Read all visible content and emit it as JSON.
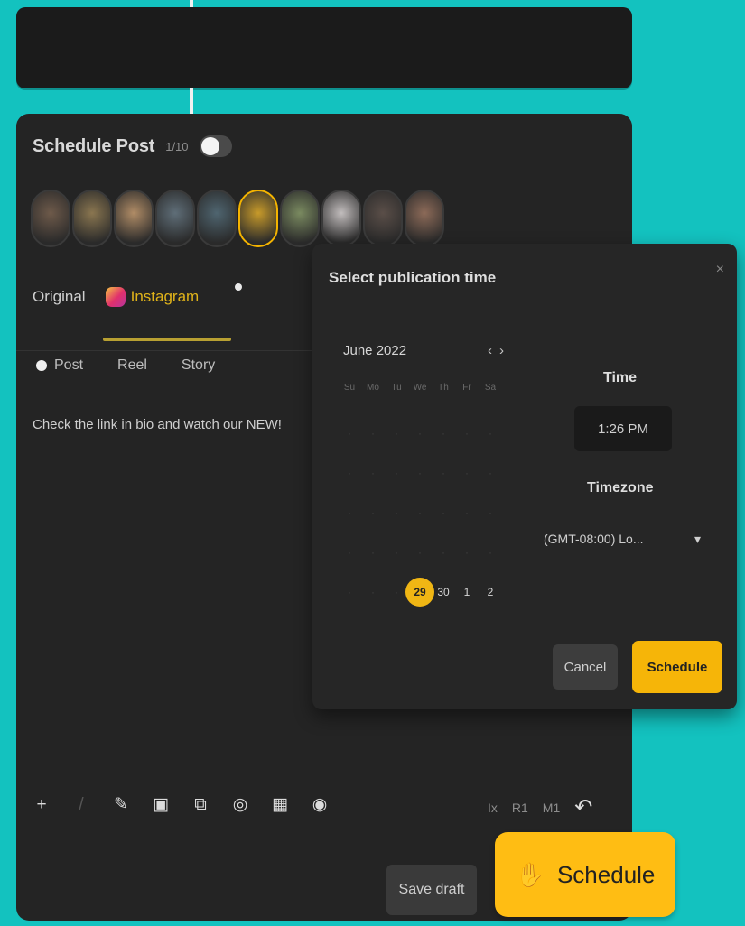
{
  "colors": {
    "page_bg": "#13c2bf",
    "panel_bg": "#242424",
    "accent": "#f6b508",
    "instagram_text": "#e0b31a"
  },
  "header": {
    "title": "Schedule Post",
    "count": "1/10",
    "toggle_on": true
  },
  "avatars": {
    "count": 10,
    "selected_index": 5,
    "colors": [
      "#6e5a4a",
      "#8a7650",
      "#b08c66",
      "#5f6e78",
      "#4f6570",
      "#c79a2a",
      "#7a8a60",
      "#c2bdbd",
      "#5a4e48",
      "#8c6a58"
    ]
  },
  "platform_tabs": {
    "original": "Original",
    "instagram": "Instagram"
  },
  "content_tabs": {
    "post": "Post",
    "reel": "Reel",
    "story": "Story"
  },
  "caption": "Check the link in bio and watch our NEW!",
  "toolbar": {
    "icons": [
      "plus-icon",
      "wand-icon",
      "link-icon",
      "image-icon",
      "copy-icon",
      "info-icon",
      "grid-icon",
      "eye-icon"
    ],
    "glyphs": [
      "+",
      "/",
      "✎",
      "▣",
      "⧉",
      "◎",
      "▦",
      "◉"
    ],
    "right_items": [
      "Ix",
      "R1",
      "M1"
    ],
    "undo_glyph": "↶"
  },
  "save_draft": "Save draft",
  "popup": {
    "title": "Select publication time",
    "close": "×",
    "month": "June 2022",
    "nav_prev": "‹",
    "nav_next": "›",
    "weekdays": [
      "Su",
      "Mo",
      "Tu",
      "We",
      "Th",
      "Fr",
      "Sa"
    ],
    "selected_day": "29",
    "visible_days": [
      "30",
      "1",
      "2"
    ],
    "time_label": "Time",
    "time_value": "1:26 PM",
    "timezone_label": "Timezone",
    "timezone_value": "(GMT-08:00) Lo...",
    "timezone_caret": "▾",
    "cancel": "Cancel",
    "schedule": "Schedule"
  },
  "schedule_button": {
    "label": "Schedule",
    "icon_glyph": "✋"
  }
}
